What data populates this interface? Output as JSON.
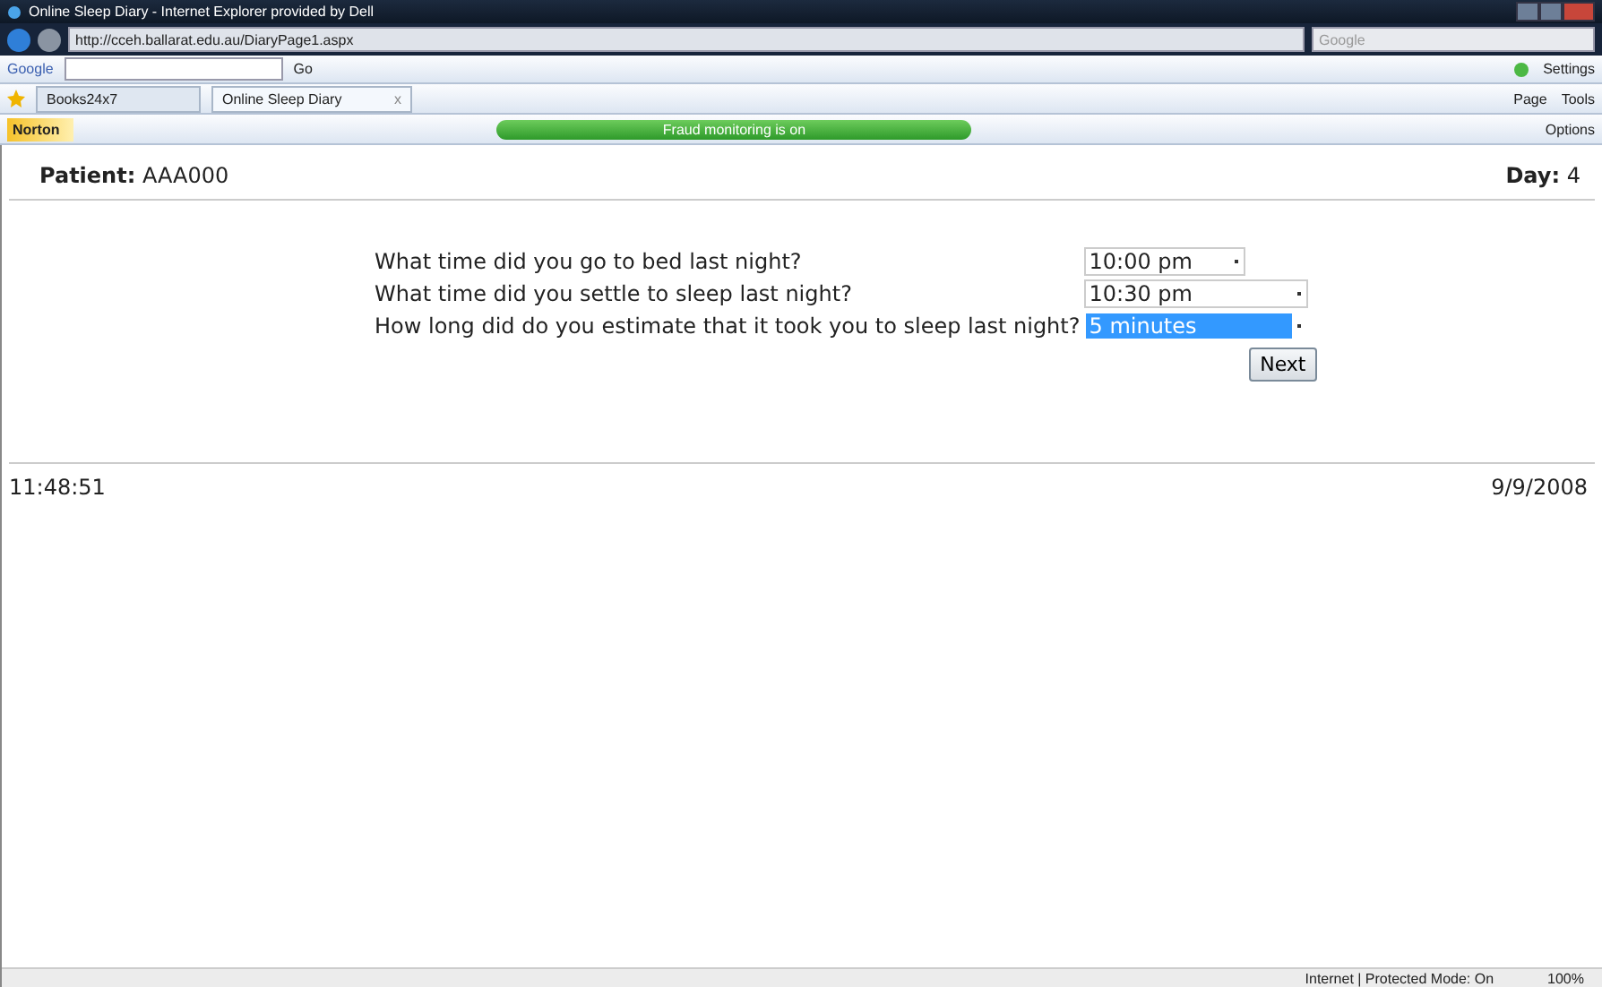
{
  "window": {
    "title": "Online Sleep Diary - Internet Explorer provided by Dell"
  },
  "address_bar": {
    "url": "http://cceh.ballarat.edu.au/DiaryPage1.aspx",
    "search_placeholder": "Google"
  },
  "google_toolbar": {
    "logo": "Google",
    "go": "Go",
    "settings": "Settings"
  },
  "tabs": [
    {
      "label": "Books24x7",
      "selected": false
    },
    {
      "label": "Online Sleep Diary",
      "selected": true,
      "close": "x"
    }
  ],
  "command_bar": [
    "Page",
    "Tools"
  ],
  "norton_bar": {
    "logo": "Norton",
    "status": "Fraud monitoring is on",
    "options": "Options"
  },
  "header": {
    "patient_label": "Patient:",
    "patient": "AAA000",
    "day_label": "Day:",
    "day": "4"
  },
  "questions": [
    {
      "text": "What time did you go to bed last night?",
      "value": "10:00 pm",
      "highlighted": false
    },
    {
      "text": "What time did you settle to sleep last night?",
      "value": "10:30 pm",
      "highlighted": false
    },
    {
      "text": "How long did do you estimate that it took you to sleep last night?",
      "value": "5 minutes",
      "highlighted": true
    }
  ],
  "next_button": "Next",
  "footer": {
    "time": "11:48:51",
    "date": "9/9/2008"
  },
  "status_bar": {
    "zone": "Internet | Protected Mode: On",
    "zoom": "100%"
  }
}
